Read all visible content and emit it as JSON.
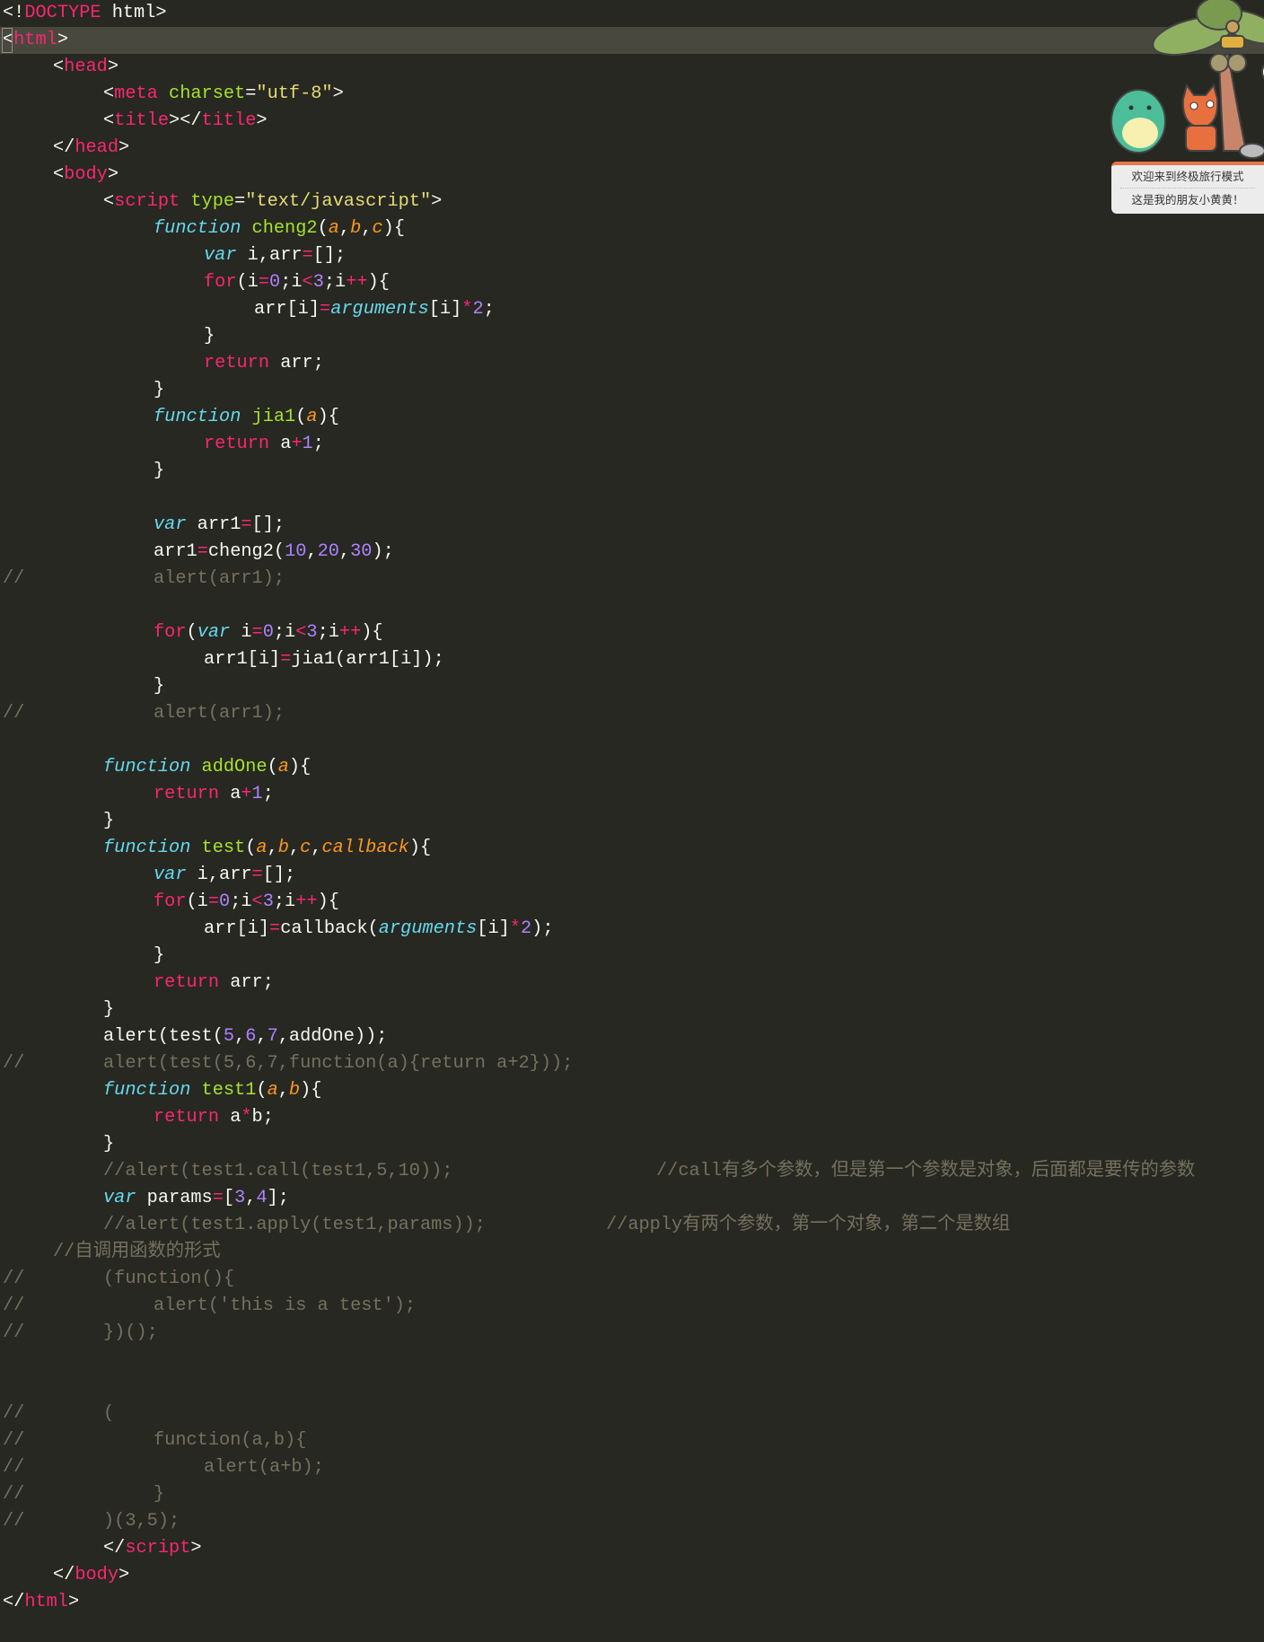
{
  "lines": [
    [
      [
        "p",
        "<!"
      ],
      [
        "t",
        "DOCTYPE"
      ],
      [
        "p",
        " html>"
      ]
    ],
    [
      [
        "p",
        "<"
      ],
      [
        "t",
        "html"
      ],
      [
        "p",
        ">"
      ]
    ],
    [
      [
        "p",
        "\t<"
      ],
      [
        "t",
        "head"
      ],
      [
        "p",
        ">"
      ]
    ],
    [
      [
        "p",
        "\t\t<"
      ],
      [
        "t",
        "meta"
      ],
      [
        "p",
        " "
      ],
      [
        "a",
        "charset"
      ],
      [
        "p",
        "="
      ],
      [
        "s",
        "\"utf-8\""
      ],
      [
        "p",
        ">"
      ]
    ],
    [
      [
        "p",
        "\t\t<"
      ],
      [
        "t",
        "title"
      ],
      [
        "p",
        "></"
      ],
      [
        "t",
        "title"
      ],
      [
        "p",
        ">"
      ]
    ],
    [
      [
        "p",
        "\t</"
      ],
      [
        "t",
        "head"
      ],
      [
        "p",
        ">"
      ]
    ],
    [
      [
        "p",
        "\t<"
      ],
      [
        "t",
        "body"
      ],
      [
        "p",
        ">"
      ]
    ],
    [
      [
        "p",
        "\t\t<"
      ],
      [
        "t",
        "script"
      ],
      [
        "p",
        " "
      ],
      [
        "a",
        "type"
      ],
      [
        "p",
        "="
      ],
      [
        "s",
        "\"text/javascript\""
      ],
      [
        "p",
        ">"
      ]
    ],
    [
      [
        "p",
        "\t\t\t"
      ],
      [
        "i",
        "function"
      ],
      [
        "p",
        " "
      ],
      [
        "f",
        "cheng2"
      ],
      [
        "p",
        "("
      ],
      [
        "g",
        "a"
      ],
      [
        "p",
        ","
      ],
      [
        "g",
        "b"
      ],
      [
        "p",
        ","
      ],
      [
        "g",
        "c"
      ],
      [
        "p",
        "){"
      ]
    ],
    [
      [
        "p",
        "\t\t\t\t"
      ],
      [
        "i",
        "var"
      ],
      [
        "p",
        " i,arr"
      ],
      [
        "k",
        "="
      ],
      [
        "p",
        "[];"
      ]
    ],
    [
      [
        "p",
        "\t\t\t\t"
      ],
      [
        "k",
        "for"
      ],
      [
        "p",
        "(i"
      ],
      [
        "k",
        "="
      ],
      [
        "n",
        "0"
      ],
      [
        "p",
        ";i"
      ],
      [
        "k",
        "<"
      ],
      [
        "n",
        "3"
      ],
      [
        "p",
        ";i"
      ],
      [
        "k",
        "++"
      ],
      [
        "p",
        "){"
      ]
    ],
    [
      [
        "p",
        "\t\t\t\t\tarr[i]"
      ],
      [
        "k",
        "="
      ],
      [
        "i",
        "arguments"
      ],
      [
        "p",
        "[i]"
      ],
      [
        "k",
        "*"
      ],
      [
        "n",
        "2"
      ],
      [
        "p",
        ";"
      ]
    ],
    [
      [
        "p",
        "\t\t\t\t}"
      ]
    ],
    [
      [
        "p",
        "\t\t\t\t"
      ],
      [
        "k",
        "return"
      ],
      [
        "p",
        " arr;"
      ]
    ],
    [
      [
        "p",
        "\t\t\t}"
      ]
    ],
    [
      [
        "p",
        "\t\t\t"
      ],
      [
        "i",
        "function"
      ],
      [
        "p",
        " "
      ],
      [
        "f",
        "jia1"
      ],
      [
        "p",
        "("
      ],
      [
        "g",
        "a"
      ],
      [
        "p",
        "){"
      ]
    ],
    [
      [
        "p",
        "\t\t\t\t"
      ],
      [
        "k",
        "return"
      ],
      [
        "p",
        " a"
      ],
      [
        "k",
        "+"
      ],
      [
        "n",
        "1"
      ],
      [
        "p",
        ";"
      ]
    ],
    [
      [
        "p",
        "\t\t\t}"
      ]
    ],
    [],
    [
      [
        "p",
        "\t\t\t"
      ],
      [
        "i",
        "var"
      ],
      [
        "p",
        " arr1"
      ],
      [
        "k",
        "="
      ],
      [
        "p",
        "[];"
      ]
    ],
    [
      [
        "p",
        "\t\t\tarr1"
      ],
      [
        "k",
        "="
      ],
      [
        "p",
        "cheng2("
      ],
      [
        "n",
        "10"
      ],
      [
        "p",
        ","
      ],
      [
        "n",
        "20"
      ],
      [
        "p",
        ","
      ],
      [
        "n",
        "30"
      ],
      [
        "p",
        ");"
      ]
    ],
    [
      [
        "c",
        "//\t\t\talert(arr1);"
      ]
    ],
    [],
    [
      [
        "p",
        "\t\t\t"
      ],
      [
        "k",
        "for"
      ],
      [
        "p",
        "("
      ],
      [
        "i",
        "var"
      ],
      [
        "p",
        " i"
      ],
      [
        "k",
        "="
      ],
      [
        "n",
        "0"
      ],
      [
        "p",
        ";i"
      ],
      [
        "k",
        "<"
      ],
      [
        "n",
        "3"
      ],
      [
        "p",
        ";i"
      ],
      [
        "k",
        "++"
      ],
      [
        "p",
        "){"
      ]
    ],
    [
      [
        "p",
        "\t\t\t\tarr1[i]"
      ],
      [
        "k",
        "="
      ],
      [
        "p",
        "jia1(arr1[i]);"
      ]
    ],
    [
      [
        "p",
        "\t\t\t}"
      ]
    ],
    [
      [
        "c",
        "//\t\t\talert(arr1);"
      ]
    ],
    [],
    [
      [
        "p",
        "\t\t"
      ],
      [
        "i",
        "function"
      ],
      [
        "p",
        " "
      ],
      [
        "f",
        "addOne"
      ],
      [
        "p",
        "("
      ],
      [
        "g",
        "a"
      ],
      [
        "p",
        "){"
      ]
    ],
    [
      [
        "p",
        "\t\t\t"
      ],
      [
        "k",
        "return"
      ],
      [
        "p",
        " a"
      ],
      [
        "k",
        "+"
      ],
      [
        "n",
        "1"
      ],
      [
        "p",
        ";"
      ]
    ],
    [
      [
        "p",
        "\t\t}"
      ]
    ],
    [
      [
        "p",
        "\t\t"
      ],
      [
        "i",
        "function"
      ],
      [
        "p",
        " "
      ],
      [
        "f",
        "test"
      ],
      [
        "p",
        "("
      ],
      [
        "g",
        "a"
      ],
      [
        "p",
        ","
      ],
      [
        "g",
        "b"
      ],
      [
        "p",
        ","
      ],
      [
        "g",
        "c"
      ],
      [
        "p",
        ","
      ],
      [
        "g",
        "callback"
      ],
      [
        "p",
        "){"
      ]
    ],
    [
      [
        "p",
        "\t\t\t"
      ],
      [
        "i",
        "var"
      ],
      [
        "p",
        " i,arr"
      ],
      [
        "k",
        "="
      ],
      [
        "p",
        "[];"
      ]
    ],
    [
      [
        "p",
        "\t\t\t"
      ],
      [
        "k",
        "for"
      ],
      [
        "p",
        "(i"
      ],
      [
        "k",
        "="
      ],
      [
        "n",
        "0"
      ],
      [
        "p",
        ";i"
      ],
      [
        "k",
        "<"
      ],
      [
        "n",
        "3"
      ],
      [
        "p",
        ";i"
      ],
      [
        "k",
        "++"
      ],
      [
        "p",
        "){"
      ]
    ],
    [
      [
        "p",
        "\t\t\t\tarr[i]"
      ],
      [
        "k",
        "="
      ],
      [
        "p",
        "callback("
      ],
      [
        "i",
        "arguments"
      ],
      [
        "p",
        "[i]"
      ],
      [
        "k",
        "*"
      ],
      [
        "n",
        "2"
      ],
      [
        "p",
        ");"
      ]
    ],
    [
      [
        "p",
        "\t\t\t}"
      ]
    ],
    [
      [
        "p",
        "\t\t\t"
      ],
      [
        "k",
        "return"
      ],
      [
        "p",
        " arr;"
      ]
    ],
    [
      [
        "p",
        "\t\t}"
      ]
    ],
    [
      [
        "p",
        "\t\talert(test("
      ],
      [
        "n",
        "5"
      ],
      [
        "p",
        ","
      ],
      [
        "n",
        "6"
      ],
      [
        "p",
        ","
      ],
      [
        "n",
        "7"
      ],
      [
        "p",
        ",addOne));"
      ]
    ],
    [
      [
        "c",
        "//\t\talert(test(5,6,7,function(a){return a+2}));"
      ]
    ],
    [
      [
        "p",
        "\t\t"
      ],
      [
        "i",
        "function"
      ],
      [
        "p",
        " "
      ],
      [
        "f",
        "test1"
      ],
      [
        "p",
        "("
      ],
      [
        "g",
        "a"
      ],
      [
        "p",
        ","
      ],
      [
        "g",
        "b"
      ],
      [
        "p",
        "){"
      ]
    ],
    [
      [
        "p",
        "\t\t\t"
      ],
      [
        "k",
        "return"
      ],
      [
        "p",
        " a"
      ],
      [
        "k",
        "*"
      ],
      [
        "p",
        "b;"
      ]
    ],
    [
      [
        "p",
        "\t\t}"
      ]
    ],
    [
      [
        "c",
        "\t\t//alert(test1.call(test1,5,10));\t\t\t\t//call有多个参数，但是第一个参数是对象，后面都是要传的参数"
      ]
    ],
    [
      [
        "p",
        "\t\t"
      ],
      [
        "i",
        "var"
      ],
      [
        "p",
        " params"
      ],
      [
        "k",
        "="
      ],
      [
        "p",
        "["
      ],
      [
        "n",
        "3"
      ],
      [
        "p",
        ","
      ],
      [
        "n",
        "4"
      ],
      [
        "p",
        "];"
      ]
    ],
    [
      [
        "c",
        "\t\t//alert(test1.apply(test1,params));\t\t\t//apply有两个参数，第一个对象，第二个是数组"
      ]
    ],
    [
      [
        "c",
        "\t//自调用函数的形式"
      ]
    ],
    [
      [
        "c",
        "//\t\t(function(){"
      ]
    ],
    [
      [
        "c",
        "//\t\t\talert('this is a test');"
      ]
    ],
    [
      [
        "c",
        "//\t\t})();"
      ]
    ],
    [],
    [],
    [
      [
        "c",
        "//\t\t("
      ]
    ],
    [
      [
        "c",
        "//\t\t\tfunction(a,b){"
      ]
    ],
    [
      [
        "c",
        "//\t\t\t\talert(a+b);"
      ]
    ],
    [
      [
        "c",
        "//\t\t\t}"
      ]
    ],
    [
      [
        "c",
        "//\t\t)(3,5);"
      ]
    ],
    [
      [
        "p",
        "\t\t</"
      ],
      [
        "t",
        "script"
      ],
      [
        "p",
        ">"
      ]
    ],
    [
      [
        "p",
        "\t</"
      ],
      [
        "t",
        "body"
      ],
      [
        "p",
        ">"
      ]
    ],
    [
      [
        "p",
        "</"
      ],
      [
        "t",
        "html"
      ],
      [
        "p",
        ">"
      ]
    ]
  ],
  "mascot": {
    "line1": "欢迎来到终极旅行模式",
    "line2": "这是我的朋友小黄黄！"
  },
  "colors": {
    "background": "#272822",
    "current_line": "#49483e",
    "tag": "#f92672",
    "attribute": "#a6e22e",
    "string": "#e6db74",
    "storage": "#66d9ef",
    "parameter": "#fd971f",
    "number": "#ae81ff",
    "comment": "#75715e"
  }
}
